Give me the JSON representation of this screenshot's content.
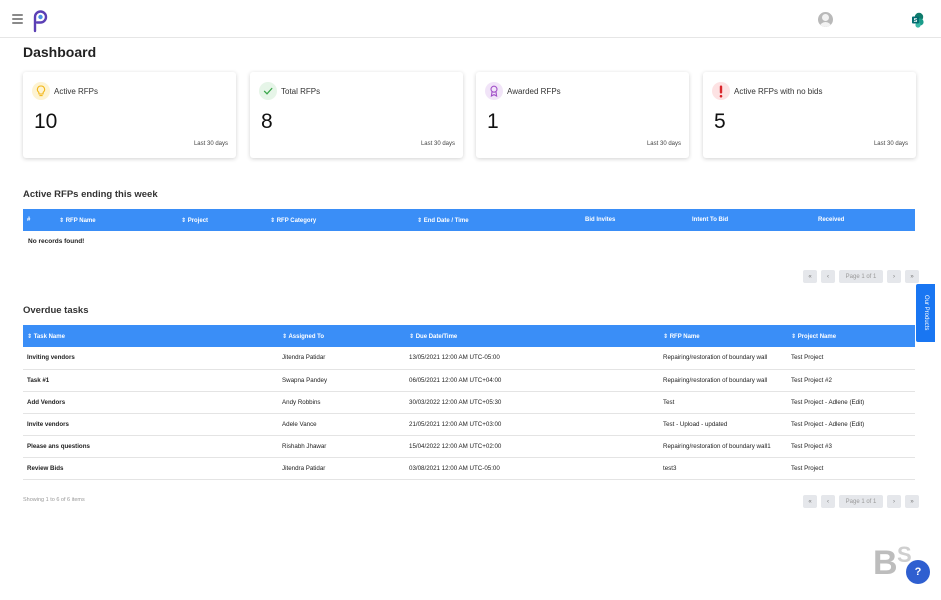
{
  "header": {
    "menu_icon": "hamburger-icon",
    "logo_icon": "p-logo-icon",
    "avatar_icon": "user-avatar-icon",
    "brand_icon": "sharepoint-icon"
  },
  "page_title": "Dashboard",
  "cards": [
    {
      "label": "Active RFPs",
      "value": "10",
      "period": "Last 30 days",
      "icon": "lightbulb-icon",
      "icon_color": "#f2b616",
      "icon_bg": "#fdf3d2"
    },
    {
      "label": "Total RFPs",
      "value": "8",
      "period": "Last 30 days",
      "icon": "check-icon",
      "icon_color": "#3aa64a",
      "icon_bg": "#e6f5e8"
    },
    {
      "label": "Awarded RFPs",
      "value": "1",
      "period": "Last 30 days",
      "icon": "award-icon",
      "icon_color": "#a14fc8",
      "icon_bg": "#f1e4f8"
    },
    {
      "label": "Active RFPs with no bids",
      "value": "5",
      "period": "Last 30 days",
      "icon": "exclamation-icon",
      "icon_color": "#d9262c",
      "icon_bg": "#fde2e3"
    }
  ],
  "active_rfps": {
    "title": "Active RFPs ending this week",
    "columns": [
      "#",
      "⇕ RFP Name",
      "⇕ Project",
      "⇕ RFP Category",
      "⇕ End Date / Time",
      "Bid Invites",
      "Intent To Bid",
      "Received"
    ],
    "empty_text": "No records found!",
    "pager": {
      "first": "«",
      "prev": "‹",
      "label": "Page 1 of 1",
      "next": "›",
      "last": "»"
    }
  },
  "overdue_tasks": {
    "title": "Overdue tasks",
    "columns": [
      "⇕ Task Name",
      "⇕ Assigned To",
      "⇕ Due Date/Time",
      "⇕ RFP Name",
      "⇕ Project Name"
    ],
    "rows": [
      [
        "Inviting vendors",
        "Jitendra Patidar",
        "13/05/2021 12:00 AM UTC-05:00",
        "Repairing/restoration of boundary wall",
        "Test Project"
      ],
      [
        "Task #1",
        "Swapna Pandey",
        "06/05/2021 12:00 AM UTC+04:00",
        "Repairing/restoration of boundary wall",
        "Test Project #2"
      ],
      [
        "Add Vendors",
        "Andy Robbins",
        "30/03/2022 12:00 AM UTC+05:30",
        "Test",
        "Test Project - Adlene (Edit)"
      ],
      [
        "Invite vendors",
        "Adele Vance",
        "21/05/2021 12:00 AM UTC+03:00",
        "Test - Upload - updated",
        "Test Project - Adlene (Edit)"
      ],
      [
        "Please ans questions",
        "Rishabh Jhawar",
        "15/04/2022 12:00 AM UTC+02:00",
        "Repairing/restoration of boundary wall1",
        "Test Project #3"
      ],
      [
        "Review Bids",
        "Jitendra Patidar",
        "03/08/2021 12:00 AM UTC-05:00",
        "test3",
        "Test Project"
      ]
    ],
    "showing": "Showing 1 to 6 of 6 items",
    "pager": {
      "first": "«",
      "prev": "‹",
      "label": "Page 1 of 1",
      "next": "›",
      "last": "»"
    }
  },
  "side_tab": "Our Products",
  "help": {
    "label": "?",
    "icon": "help-icon"
  },
  "colors": {
    "accent": "#3a8ef7",
    "side_tab": "#1976f2"
  }
}
